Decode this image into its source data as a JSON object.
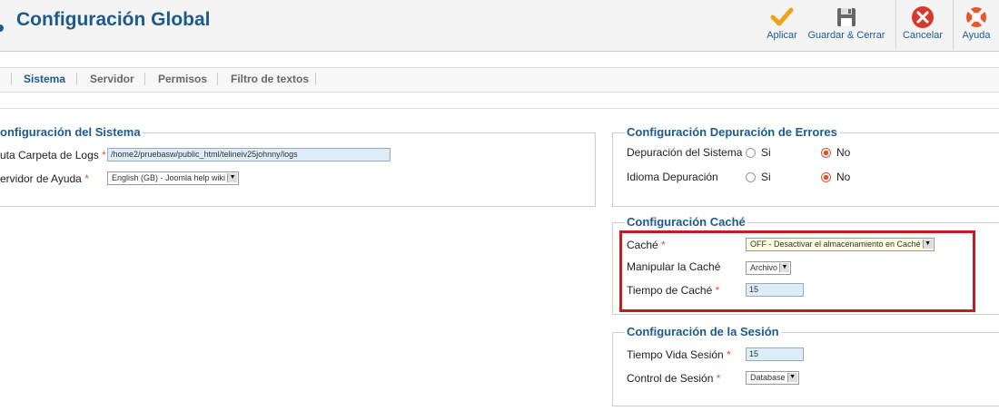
{
  "header": {
    "title": "Configuración Global"
  },
  "toolbar": {
    "apply": "Aplicar",
    "save_close": "Guardar & Cerrar",
    "cancel": "Cancelar",
    "help": "Ayuda"
  },
  "tabs": [
    "Sistema",
    "Servidor",
    "Permisos",
    "Filtro de textos"
  ],
  "active_tab": "Sistema",
  "system": {
    "legend": "onfiguración del Sistema",
    "log_path_label": "uta Carpeta de Logs",
    "log_path_value": "/home2/pruebasw/public_html/telineiv25johnny/logs",
    "help_server_label": "ervidor de Ayuda",
    "help_server_value": "English (GB) - Joomla help wiki"
  },
  "debug": {
    "legend": "Configuración Depuración de Errores",
    "system_debug_label": "Depuración del Sistema",
    "language_debug_label": "Idioma Depuración",
    "yes": "Si",
    "no": "No",
    "system_debug_value": "No",
    "language_debug_value": "No"
  },
  "cache": {
    "legend": "Configuración Caché",
    "cache_label": "Caché",
    "cache_value": "OFF - Desactivar el almacenamiento en Caché",
    "handler_label": "Manipular la Caché",
    "handler_value": "Archivo",
    "time_label": "Tiempo de Caché",
    "time_value": "15"
  },
  "session": {
    "legend": "Configuración de la Sesión",
    "lifetime_label": "Tiempo Vida Sesión",
    "lifetime_value": "15",
    "handler_label": "Control de Sesión",
    "handler_value": "Database"
  },
  "required_mark": "*",
  "colors": {
    "brand": "#1d5a8e",
    "highlight": "#c31e1e",
    "required": "#e0532d"
  }
}
